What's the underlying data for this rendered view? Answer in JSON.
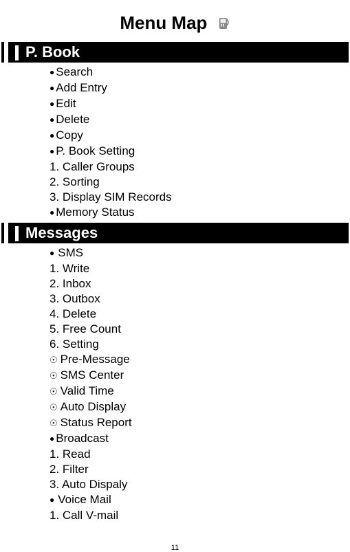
{
  "title": "Menu Map",
  "page_number": "11",
  "sections": [
    {
      "header": "P. Book",
      "items": [
        {
          "style": "bullet",
          "text": "Search"
        },
        {
          "style": "bullet",
          "text": "Add Entry"
        },
        {
          "style": "bullet",
          "text": "Edit"
        },
        {
          "style": "bullet",
          "text": "Delete"
        },
        {
          "style": "bullet",
          "text": "Copy"
        },
        {
          "style": "bullet",
          "text": "P. Book Setting"
        },
        {
          "style": "num",
          "text": "1. Caller Groups"
        },
        {
          "style": "num",
          "text": "2. Sorting"
        },
        {
          "style": "num",
          "text": "3. Display SIM Records"
        },
        {
          "style": "bullet",
          "text": "Memory Status"
        }
      ]
    },
    {
      "header": "Messages",
      "items": [
        {
          "style": "bullet-space",
          "text": "SMS"
        },
        {
          "style": "num",
          "text": "1. Write"
        },
        {
          "style": "num",
          "text": "2. Inbox"
        },
        {
          "style": "num",
          "text": "3. Outbox"
        },
        {
          "style": "num",
          "text": "4. Delete"
        },
        {
          "style": "num",
          "text": "5. Free Count"
        },
        {
          "style": "num",
          "text": "6. Setting"
        },
        {
          "style": "circled",
          "text": "Pre-Message"
        },
        {
          "style": "circled",
          "text": "SMS Center"
        },
        {
          "style": "circled",
          "text": "Valid Time"
        },
        {
          "style": "circled",
          "text": "Auto Display"
        },
        {
          "style": "circled",
          "text": "Status Report"
        },
        {
          "style": "bullet",
          "text": "Broadcast"
        },
        {
          "style": "num",
          "text": "1. Read"
        },
        {
          "style": "num",
          "text": "2. Filter"
        },
        {
          "style": "num",
          "text": "3. Auto Dispaly"
        },
        {
          "style": "bullet-space",
          "text": "Voice Mail"
        },
        {
          "style": "num",
          "text": "1. Call V-mail"
        }
      ]
    }
  ]
}
